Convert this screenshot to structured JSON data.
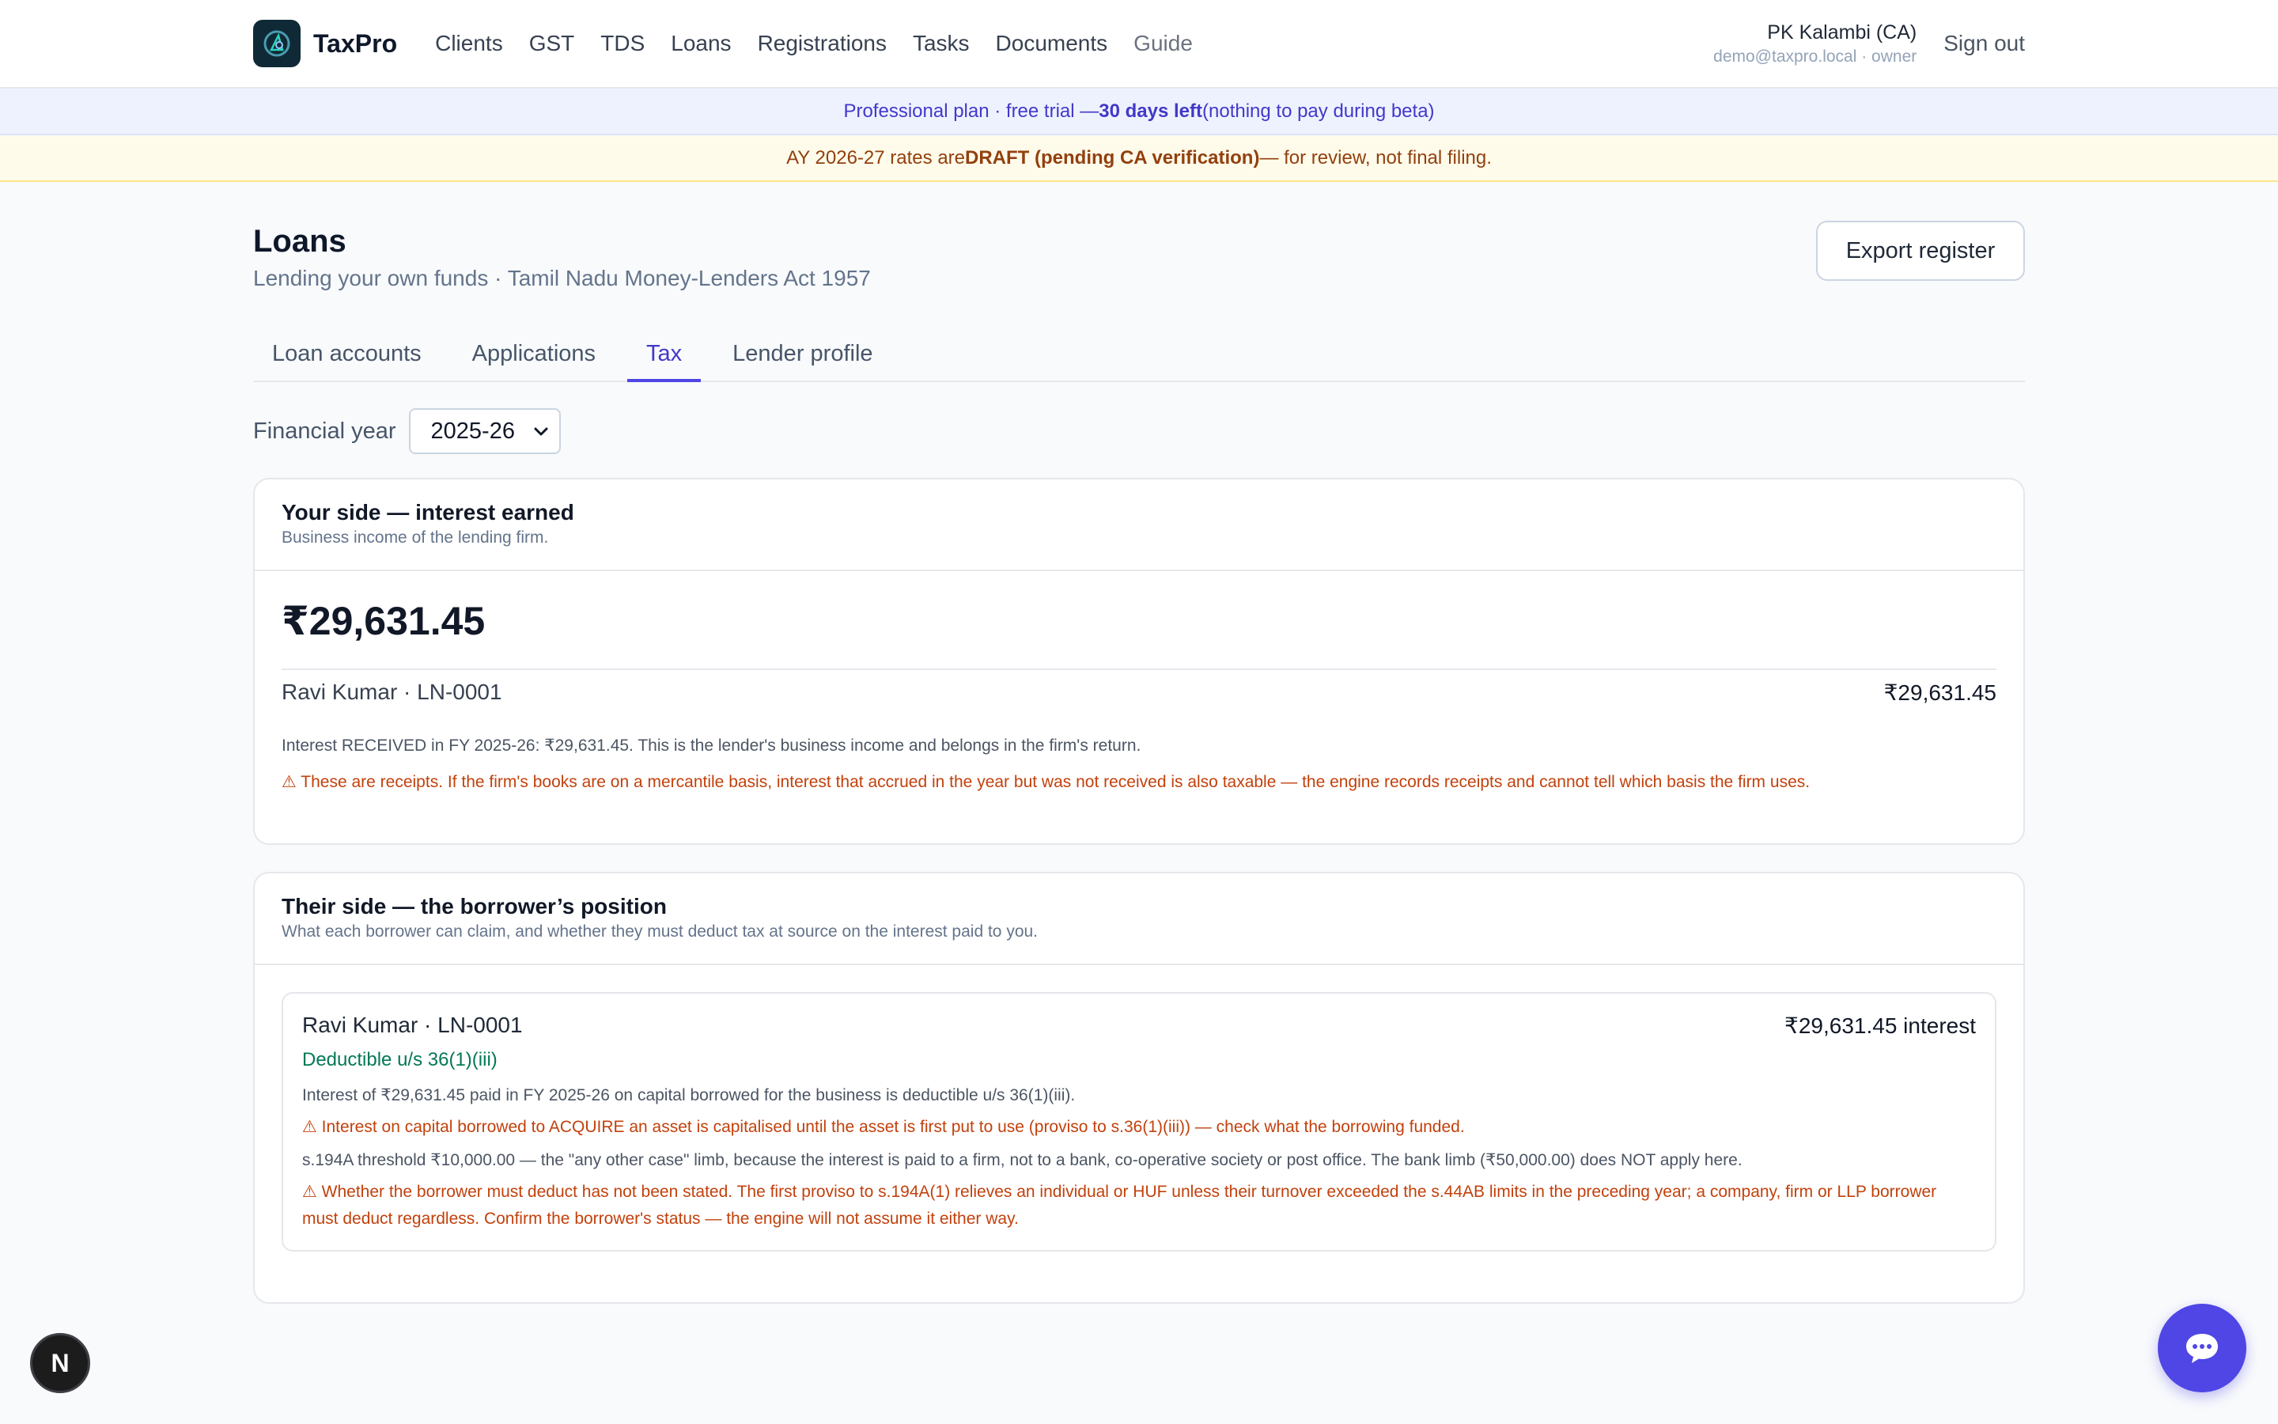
{
  "nav": {
    "brand": "TaxPro",
    "links": [
      "Clients",
      "GST",
      "TDS",
      "Loans",
      "Registrations",
      "Tasks",
      "Documents",
      "Guide"
    ],
    "user_name": "PK Kalambi (CA)",
    "user_sub": "demo@taxpro.local · owner",
    "sign_out": "Sign out"
  },
  "plan_banner": {
    "prefix": "Professional plan · free trial — ",
    "highlight": "30 days left",
    "suffix": " (nothing to pay during beta)"
  },
  "draft_banner": {
    "prefix": "AY 2026-27 rates are ",
    "highlight": "DRAFT (pending CA verification)",
    "suffix": " — for review, not final filing."
  },
  "page": {
    "title": "Loans",
    "subtitle": "Lending your own funds · Tamil Nadu Money-Lenders Act 1957",
    "export_label": "Export register",
    "tabs": [
      "Loan accounts",
      "Applications",
      "Tax",
      "Lender profile"
    ],
    "active_tab": "Tax"
  },
  "filter": {
    "label": "Financial year",
    "value": "2025-26"
  },
  "your_side": {
    "title": "Your side — interest earned",
    "subtitle": "Business income of the lending firm.",
    "total": "₹29,631.45",
    "row_name": "Ravi Kumar · LN-0001",
    "row_amount": "₹29,631.45",
    "info": "Interest RECEIVED in FY 2025-26: ₹29,631.45. This is the lender's business income and belongs in the firm's return.",
    "warning": "⚠ These are receipts. If the firm's books are on a mercantile basis, interest that accrued in the year but was not received is also taxable — the engine records receipts and cannot tell which basis the firm uses."
  },
  "their_side": {
    "title": "Their side — the borrower’s position",
    "subtitle": "What each borrower can claim, and whether they must deduct tax at source on the interest paid to you.",
    "borrower": {
      "name": "Ravi Kumar · LN-0001",
      "interest": "₹29,631.45 interest",
      "status": "Deductible u/s 36(1)(iii)",
      "line1": "Interest of ₹29,631.45 paid in FY 2025-26 on capital borrowed for the business is deductible u/s 36(1)(iii).",
      "line2": "⚠ Interest on capital borrowed to ACQUIRE an asset is capitalised until the asset is first put to use (proviso to s.36(1)(iii)) — check what the borrowing funded.",
      "line3": "s.194A threshold ₹10,000.00 — the \"any other case\" limb, because the interest is paid to a firm, not to a bank, co-operative society or post office. The bank limb (₹50,000.00) does NOT apply here.",
      "line4": "⚠ Whether the borrower must deduct has not been stated. The first proviso to s.194A(1) relieves an individual or HUF unless their turnover exceeded the s.44AB limits in the preceding year; a company, firm or LLP borrower must deduct regardless. Confirm the borrower's status — the engine will not assume it either way."
    }
  },
  "dev_badge": "N",
  "colors": {
    "accent": "#4f46e5",
    "warning": "#c2410c",
    "success": "#047857"
  }
}
